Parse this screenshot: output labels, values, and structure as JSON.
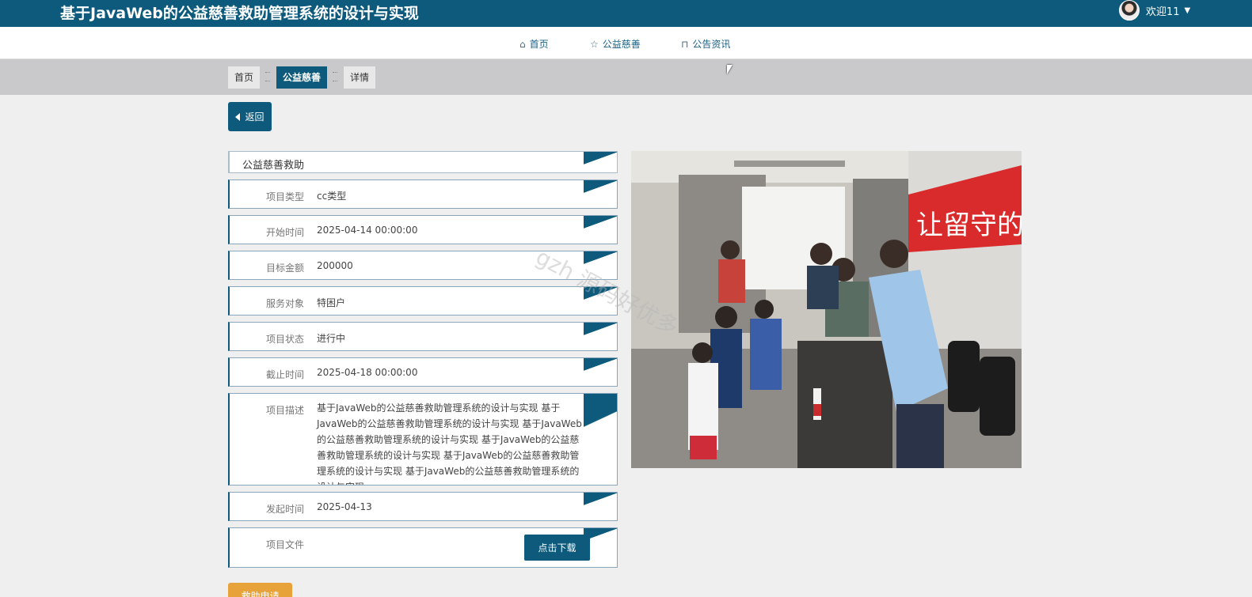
{
  "header": {
    "title": "基于JavaWeb的公益慈善救助管理系统的设计与实现",
    "welcome": "欢迎11"
  },
  "nav": {
    "items": [
      {
        "label": "首页",
        "icon": "home-icon"
      },
      {
        "label": "公益慈善",
        "icon": "star-icon"
      },
      {
        "label": "公告资讯",
        "icon": "bag-icon"
      }
    ]
  },
  "breadcrumb": {
    "items": [
      "首页",
      "公益慈善",
      "详情"
    ]
  },
  "actions": {
    "back": "返回",
    "download": "点击下载",
    "apply": "救助申请"
  },
  "detail": {
    "heading": "公益慈善救助",
    "fields": [
      {
        "label": "项目类型",
        "value": "cc类型"
      },
      {
        "label": "开始时间",
        "value": "2025-04-14 00:00:00"
      },
      {
        "label": "目标金额",
        "value": "200000"
      },
      {
        "label": "服务对象",
        "value": "特困户"
      },
      {
        "label": "项目状态",
        "value": "进行中"
      },
      {
        "label": "截止时间",
        "value": "2025-04-18 00:00:00"
      },
      {
        "label": "项目描述",
        "value": "基于JavaWeb的公益慈善救助管理系统的设计与实现 基于JavaWeb的公益慈善救助管理系统的设计与实现 基于JavaWeb的公益慈善救助管理系统的设计与实现 基于JavaWeb的公益慈善救助管理系统的设计与实现 基于JavaWeb的公益慈善救助管理系统的设计与实现 基于JavaWeb的公益慈善救助管理系统的设计与实现"
      },
      {
        "label": "发起时间",
        "value": "2025-04-13"
      },
      {
        "label": "项目文件",
        "value": ""
      }
    ]
  },
  "photo": {
    "banner_text": "让留守的花"
  },
  "watermark": "gzh 源码好优多",
  "colors": {
    "primary": "#0d5a7c",
    "apply": "#e7a23a",
    "banner": "#d92b2b"
  }
}
